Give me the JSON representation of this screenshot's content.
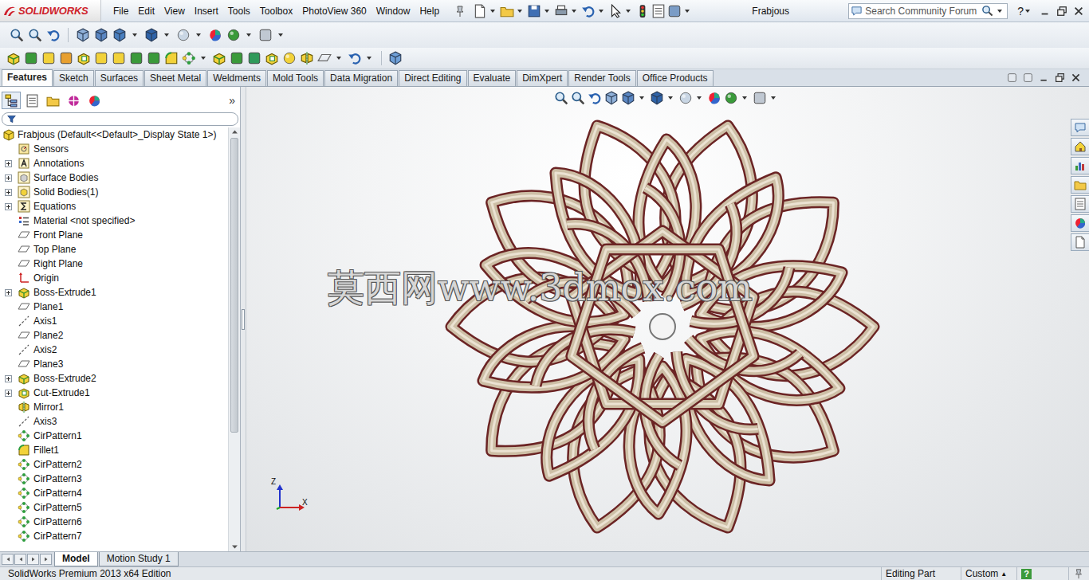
{
  "window": {
    "title": "Frabjous"
  },
  "logo": {
    "text": "SOLIDWORKS"
  },
  "menu": [
    "File",
    "Edit",
    "View",
    "Insert",
    "Tools",
    "Toolbox",
    "PhotoView 360",
    "Window",
    "Help"
  ],
  "search": {
    "placeholder": "Search Community Forum"
  },
  "help": {
    "label": "?"
  },
  "command_tabs": [
    {
      "label": "Features",
      "selected": true
    },
    {
      "label": "Sketch",
      "selected": false
    },
    {
      "label": "Surfaces",
      "selected": false
    },
    {
      "label": "Sheet Metal",
      "selected": false
    },
    {
      "label": "Weldments",
      "selected": false
    },
    {
      "label": "Mold Tools",
      "selected": false
    },
    {
      "label": "Data Migration",
      "selected": false
    },
    {
      "label": "Direct Editing",
      "selected": false
    },
    {
      "label": "Evaluate",
      "selected": false
    },
    {
      "label": "DimXpert",
      "selected": false
    },
    {
      "label": "Render Tools",
      "selected": false
    },
    {
      "label": "Office Products",
      "selected": false
    }
  ],
  "panel_tabs": [
    {
      "kind": "feature",
      "selected": true
    },
    {
      "kind": "property",
      "selected": false
    },
    {
      "kind": "config",
      "selected": false
    },
    {
      "kind": "dimxpert",
      "selected": false
    },
    {
      "kind": "display",
      "selected": false
    }
  ],
  "panel_expand": "»",
  "tree": {
    "root": {
      "label": "Frabjous (Default<<Default>_Display State 1>)",
      "kind": "part"
    },
    "items": [
      {
        "label": "Sensors",
        "kind": "sensor"
      },
      {
        "label": "Annotations",
        "kind": "annotation",
        "expanded": false
      },
      {
        "label": "Surface Bodies",
        "kind": "surface",
        "expanded": false
      },
      {
        "label": "Solid Bodies(1)",
        "kind": "solid",
        "expanded": false
      },
      {
        "label": "Equations",
        "kind": "equation",
        "expanded": false
      },
      {
        "label": "Material <not specified>",
        "kind": "material"
      },
      {
        "label": "Front Plane",
        "kind": "plane"
      },
      {
        "label": "Top Plane",
        "kind": "plane"
      },
      {
        "label": "Right Plane",
        "kind": "plane"
      },
      {
        "label": "Origin",
        "kind": "origin"
      },
      {
        "label": "Boss-Extrude1",
        "kind": "extrude",
        "expanded": false
      },
      {
        "label": "Plane1",
        "kind": "plane"
      },
      {
        "label": "Axis1",
        "kind": "axis"
      },
      {
        "label": "Plane2",
        "kind": "plane"
      },
      {
        "label": "Axis2",
        "kind": "axis"
      },
      {
        "label": "Plane3",
        "kind": "plane"
      },
      {
        "label": "Boss-Extrude2",
        "kind": "extrude",
        "expanded": false
      },
      {
        "label": "Cut-Extrude1",
        "kind": "cut",
        "expanded": false
      },
      {
        "label": "Mirror1",
        "kind": "mirror"
      },
      {
        "label": "Axis3",
        "kind": "axis"
      },
      {
        "label": "CirPattern1",
        "kind": "pattern"
      },
      {
        "label": "Fillet1",
        "kind": "fillet"
      },
      {
        "label": "CirPattern2",
        "kind": "pattern"
      },
      {
        "label": "CirPattern3",
        "kind": "pattern"
      },
      {
        "label": "CirPattern4",
        "kind": "pattern"
      },
      {
        "label": "CirPattern5",
        "kind": "pattern"
      },
      {
        "label": "CirPattern6",
        "kind": "pattern"
      },
      {
        "label": "CirPattern7",
        "kind": "pattern"
      }
    ]
  },
  "watermark": "莫西网www.3dmox.com",
  "triad": {
    "z": "Z",
    "x": "X"
  },
  "bottom_tabs": [
    {
      "label": "Model",
      "selected": true
    },
    {
      "label": "Motion Study 1",
      "selected": false
    }
  ],
  "status_bar": {
    "edition": "SolidWorks Premium 2013 x64 Edition",
    "mode": "Editing Part",
    "units": "Custom",
    "units_arrow": "▲",
    "help": "?"
  }
}
